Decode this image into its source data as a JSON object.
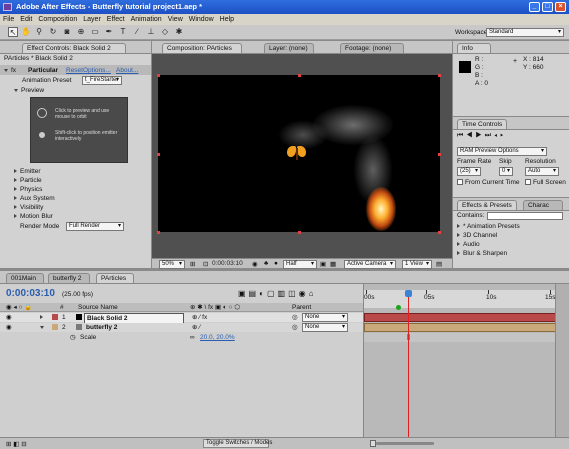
{
  "app": {
    "title": "Adobe After Effects - Butterfly tutorial project1.aep *"
  },
  "window_buttons": [
    "_",
    "□",
    "×"
  ],
  "menu": [
    "File",
    "Edit",
    "Composition",
    "Layer",
    "Effect",
    "Animation",
    "View",
    "Window",
    "Help"
  ],
  "workspace": {
    "label": "Workspace:",
    "value": "Standard"
  },
  "effect_controls": {
    "tab": "Effect Controls: Black Solid 2",
    "subtitle": "PArticles * Black Solid 2",
    "effect_name": "Particular",
    "reset": "Reset",
    "options": "Options...",
    "about": "About...",
    "preset_label": "Animation Preset",
    "preset_value": "t_FireStarter",
    "preview_label": "Preview",
    "preview_hint1": "Click to preview and use mouse to orbit",
    "preview_hint2": "Shift-click to position emitter interactively",
    "groups": [
      "Emitter",
      "Particle",
      "Physics",
      "Aux System",
      "Visibility",
      "Motion Blur"
    ],
    "render_mode_label": "Render Mode",
    "render_mode_value": "Full Render"
  },
  "composition": {
    "tab": "Composition: PArticles",
    "layer_tab": "Layer: (none)",
    "footage_tab": "Footage: (none)",
    "zoom": "50%",
    "timecode": "0:00:03:10",
    "resolution": "Half",
    "camera": "Active Camera",
    "views": "1 View"
  },
  "info": {
    "tab": "Info",
    "r": "R :",
    "g": "G :",
    "b": "B :",
    "a": "A : 0",
    "x": "X : 814",
    "y": "Y : 660"
  },
  "time_controls": {
    "tab": "Time Controls",
    "ram_preview": "RAM Preview Options",
    "frame_rate_label": "Frame Rate",
    "frame_rate_value": "(25)",
    "skip_label": "Skip",
    "skip_value": "0",
    "resolution_label": "Resolution",
    "resolution_value": "Auto",
    "from_current": "From Current Time",
    "full_screen": "Full Screen"
  },
  "effects_presets": {
    "tab": "Effects & Presets",
    "tab2": "Charac",
    "contains_label": "Contains:",
    "items": [
      "* Animation Presets",
      "3D Channel",
      "Audio",
      "Blur & Sharpen"
    ]
  },
  "timeline": {
    "tabs": [
      "001Main",
      "butterfly 2",
      "PArticles"
    ],
    "timecode": "0:00:03:10",
    "fps": "(25.00 fps)",
    "col_source": "Source Name",
    "col_parent": "Parent",
    "layers": [
      {
        "num": "1",
        "name": "Black Solid 2",
        "parent": "None",
        "color": "#b84a4a"
      },
      {
        "num": "2",
        "name": "butterfly 2",
        "parent": "None",
        "color": "#c9a87a"
      }
    ],
    "scale_label": "Scale",
    "scale_value": "20.0, 20.0%",
    "ruler": [
      "00s",
      "05s",
      "10s",
      "15s"
    ],
    "toggle_label": "Toggle Switches / Modes"
  }
}
